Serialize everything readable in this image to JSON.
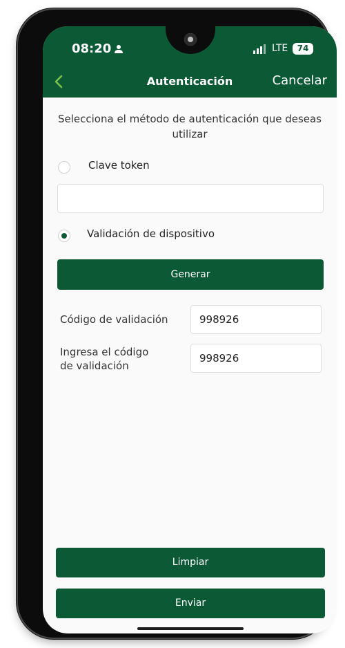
{
  "status_bar": {
    "time": "08:20",
    "network": "LTE",
    "battery": "74",
    "icons": [
      "person-icon",
      "signal-icon"
    ]
  },
  "header": {
    "title": "Autenticación",
    "cancel_label": "Cancelar",
    "back_icon": "chevron-left-icon",
    "accent_color": "#0b5a35"
  },
  "instruction": "Selecciona el método de autenticación que deseas utilizar",
  "options": [
    {
      "label": "Clave token",
      "selected": false
    },
    {
      "label": "Validación de dispositivo",
      "selected": true
    }
  ],
  "token_input": {
    "value": "",
    "placeholder": ""
  },
  "buttons": {
    "generate": "Generar",
    "clear": "Limpiar",
    "send": "Enviar"
  },
  "fields": [
    {
      "label": "Código de validación",
      "value": "998926"
    },
    {
      "label": "Ingresa el código de validación",
      "value": "998926"
    }
  ]
}
